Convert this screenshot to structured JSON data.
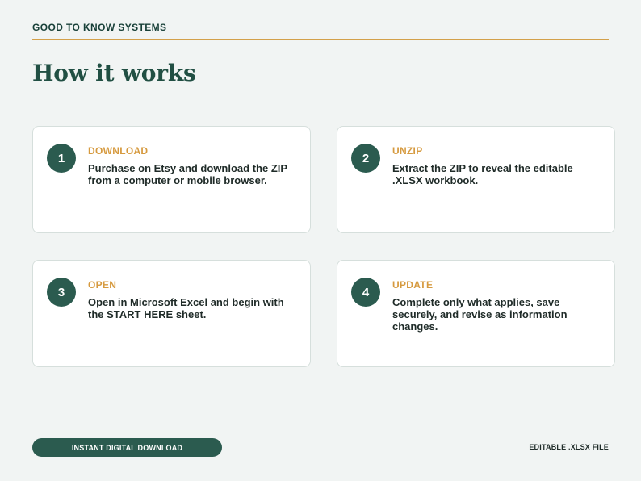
{
  "header": {
    "brand": "GOOD TO KNOW SYSTEMS"
  },
  "page": {
    "title": "How it works"
  },
  "steps": [
    {
      "number": "1",
      "title": "DOWNLOAD",
      "text": "Purchase on Etsy and download the ZIP from a computer or mobile browser."
    },
    {
      "number": "2",
      "title": "UNZIP",
      "text": "Extract the ZIP to reveal the editable .XLSX workbook."
    },
    {
      "number": "3",
      "title": "OPEN",
      "text": "Open in Microsoft Excel and begin with the START HERE sheet."
    },
    {
      "number": "4",
      "title": "UPDATE",
      "text": "Complete only what applies, save securely, and revise as information changes."
    }
  ],
  "footer": {
    "pill_label": "INSTANT DIGITAL DOWNLOAD",
    "right_label": "EDITABLE .XLSX FILE"
  },
  "colors": {
    "background": "#f1f4f3",
    "brand_green": "#2b5b4f",
    "accent_gold": "#d69a3f"
  }
}
